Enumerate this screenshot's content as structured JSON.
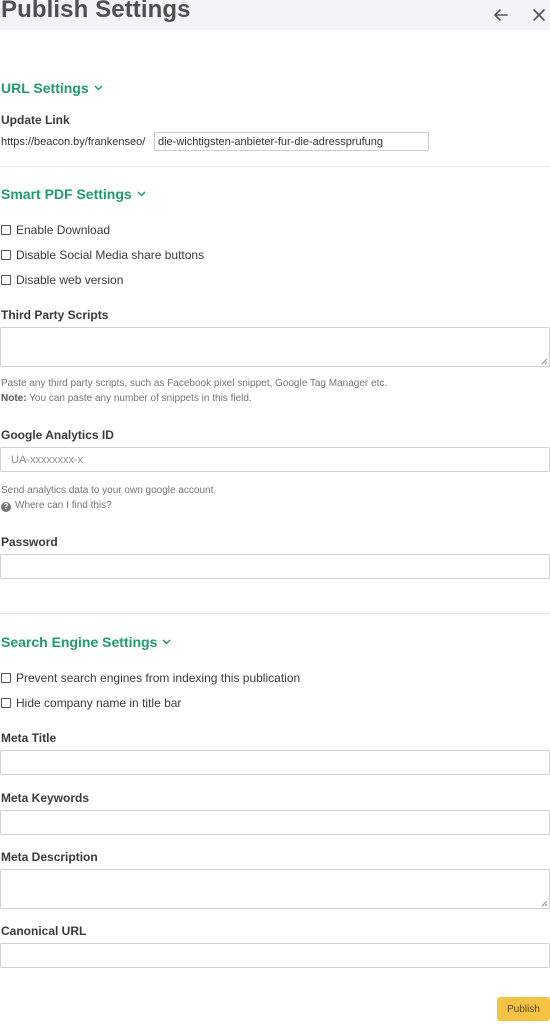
{
  "header": {
    "title": "Publish Settings",
    "back_icon": "arrow-left-icon",
    "close_icon": "close-icon"
  },
  "url_settings": {
    "title": "URL Settings",
    "update_link_label": "Update Link",
    "url_prefix": "https://beacon.by/frankenseo/",
    "slug_value": "die-wichtigsten-anbieter-fur-die-adressprufung"
  },
  "smart_pdf": {
    "title": "Smart PDF Settings",
    "enable_download": "Enable Download",
    "disable_social": "Disable Social Media share buttons",
    "disable_web": "Disable web version",
    "third_party_label": "Third Party Scripts",
    "third_party_help": "Paste any third party scripts, such as Facebook pixel snippet, Google Tag Manager etc.",
    "note_bold": "Note:",
    "note_text": " You can paste any number of snippets in this field.",
    "ga_label": "Google Analytics ID",
    "ga_placeholder": "UA-xxxxxxxx-x",
    "ga_help": "Send analytics data to your own google account",
    "ga_where": "Where can I find this?",
    "password_label": "Password"
  },
  "search_engine": {
    "title": "Search Engine Settings",
    "prevent_indexing": "Prevent search engines from indexing this publication",
    "hide_company": "Hide company name in title bar",
    "meta_title_label": "Meta Title",
    "meta_keywords_label": "Meta Keywords",
    "meta_description_label": "Meta Description",
    "canonical_label": "Canonical URL"
  },
  "footer": {
    "publish_label": "Publish"
  },
  "colors": {
    "accent_green": "#1e9c6a",
    "publish_yellow": "#f6c244",
    "header_bg": "#f3f4f6"
  }
}
